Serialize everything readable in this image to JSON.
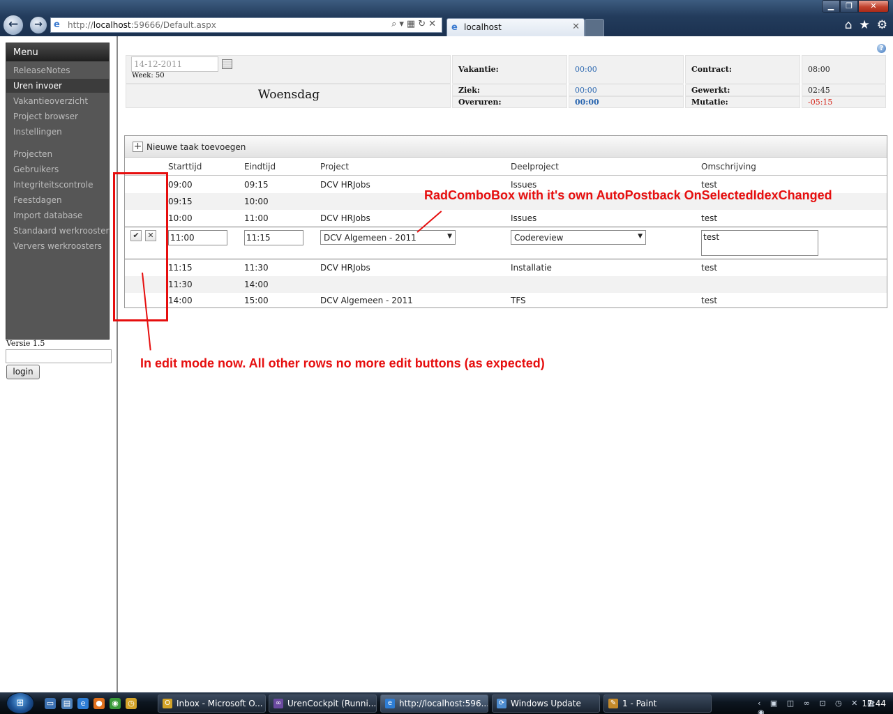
{
  "browser": {
    "url_prefix": "http://",
    "url_host": "localhost",
    "url_rest": ":59666/Default.aspx",
    "tab_title": "localhost",
    "tab_close": "✕",
    "back_glyph": "←",
    "forward_glyph": "→",
    "toolbar_icons": [
      "home-icon",
      "favorites-star-icon",
      "settings-gear-icon"
    ]
  },
  "sidebar": {
    "menu_title": "Menu",
    "items": [
      {
        "label": "ReleaseNotes",
        "selected": false
      },
      {
        "label": "Uren invoer",
        "selected": true
      },
      {
        "label": "Vakantieoverzicht",
        "selected": false
      },
      {
        "label": "Project browser",
        "selected": false
      },
      {
        "label": "Instellingen",
        "selected": false
      },
      {
        "label": "Projecten",
        "selected": false
      },
      {
        "label": "Gebruikers",
        "selected": false
      },
      {
        "label": "Integriteitscontrole",
        "selected": false
      },
      {
        "label": "Feestdagen",
        "selected": false
      },
      {
        "label": "Import database",
        "selected": false
      },
      {
        "label": "Standaard werkrooster",
        "selected": false
      },
      {
        "label": "Ververs werkroosters",
        "selected": false
      }
    ],
    "version": "Versie 1.5",
    "login_button": "login"
  },
  "summary": {
    "date_value": "14-12-2011",
    "week": "Week: 50",
    "day": "Woensdag",
    "vakantie_label": "Vakantie:",
    "vakantie_value": "00:00",
    "contract_label": "Contract:",
    "contract_value": "08:00",
    "ziek_label": "Ziek:",
    "ziek_value": "00:00",
    "gewerkt_label": "Gewerkt:",
    "gewerkt_value": "02:45",
    "overuren_label": "Overuren:",
    "overuren_value": "00:00",
    "mutatie_label": "Mutatie:",
    "mutatie_value": "-05:15"
  },
  "grid": {
    "add_task_label": "Nieuwe taak toevoegen",
    "columns": [
      "Starttijd",
      "Eindtijd",
      "Project",
      "Deelproject",
      "Omschrijving"
    ],
    "rows_before": [
      {
        "start": "09:00",
        "end": "09:15",
        "project": "DCV HRJobs",
        "deelproject": "Issues",
        "omschrijving": "test"
      },
      {
        "start": "09:15",
        "end": "10:00",
        "project": "",
        "deelproject": "",
        "omschrijving": ""
      },
      {
        "start": "10:00",
        "end": "11:00",
        "project": "DCV HRJobs",
        "deelproject": "Issues",
        "omschrijving": "test"
      }
    ],
    "edit_row": {
      "start": "11:00",
      "end": "11:15",
      "project": "DCV Algemeen - 2011",
      "deelproject": "Codereview",
      "omschrijving": "test",
      "ok_glyph": "✔",
      "cancel_glyph": "✕"
    },
    "rows_after": [
      {
        "start": "11:15",
        "end": "11:30",
        "project": "DCV HRJobs",
        "deelproject": "Installatie",
        "omschrijving": "test"
      },
      {
        "start": "11:30",
        "end": "14:00",
        "project": "",
        "deelproject": "",
        "omschrijving": ""
      },
      {
        "start": "14:00",
        "end": "15:00",
        "project": "DCV Algemeen - 2011",
        "deelproject": "TFS",
        "omschrijving": "test"
      }
    ]
  },
  "annotations": {
    "combo_note": "RadComboBox with it's own AutoPostback OnSelectedIdexChanged",
    "edit_note": "In edit mode now. All other rows no more edit buttons (as expected)",
    "color": "#e60e0e"
  },
  "taskbar": {
    "tasks": [
      {
        "label": "Inbox - Microsoft O...",
        "active": false
      },
      {
        "label": "UrenCockpit (Runni...",
        "active": false
      },
      {
        "label": "http://localhost:596...",
        "active": true
      },
      {
        "label": "Windows Update",
        "active": false
      },
      {
        "label": "1 - Paint",
        "active": false
      }
    ],
    "clock": "17:44"
  }
}
